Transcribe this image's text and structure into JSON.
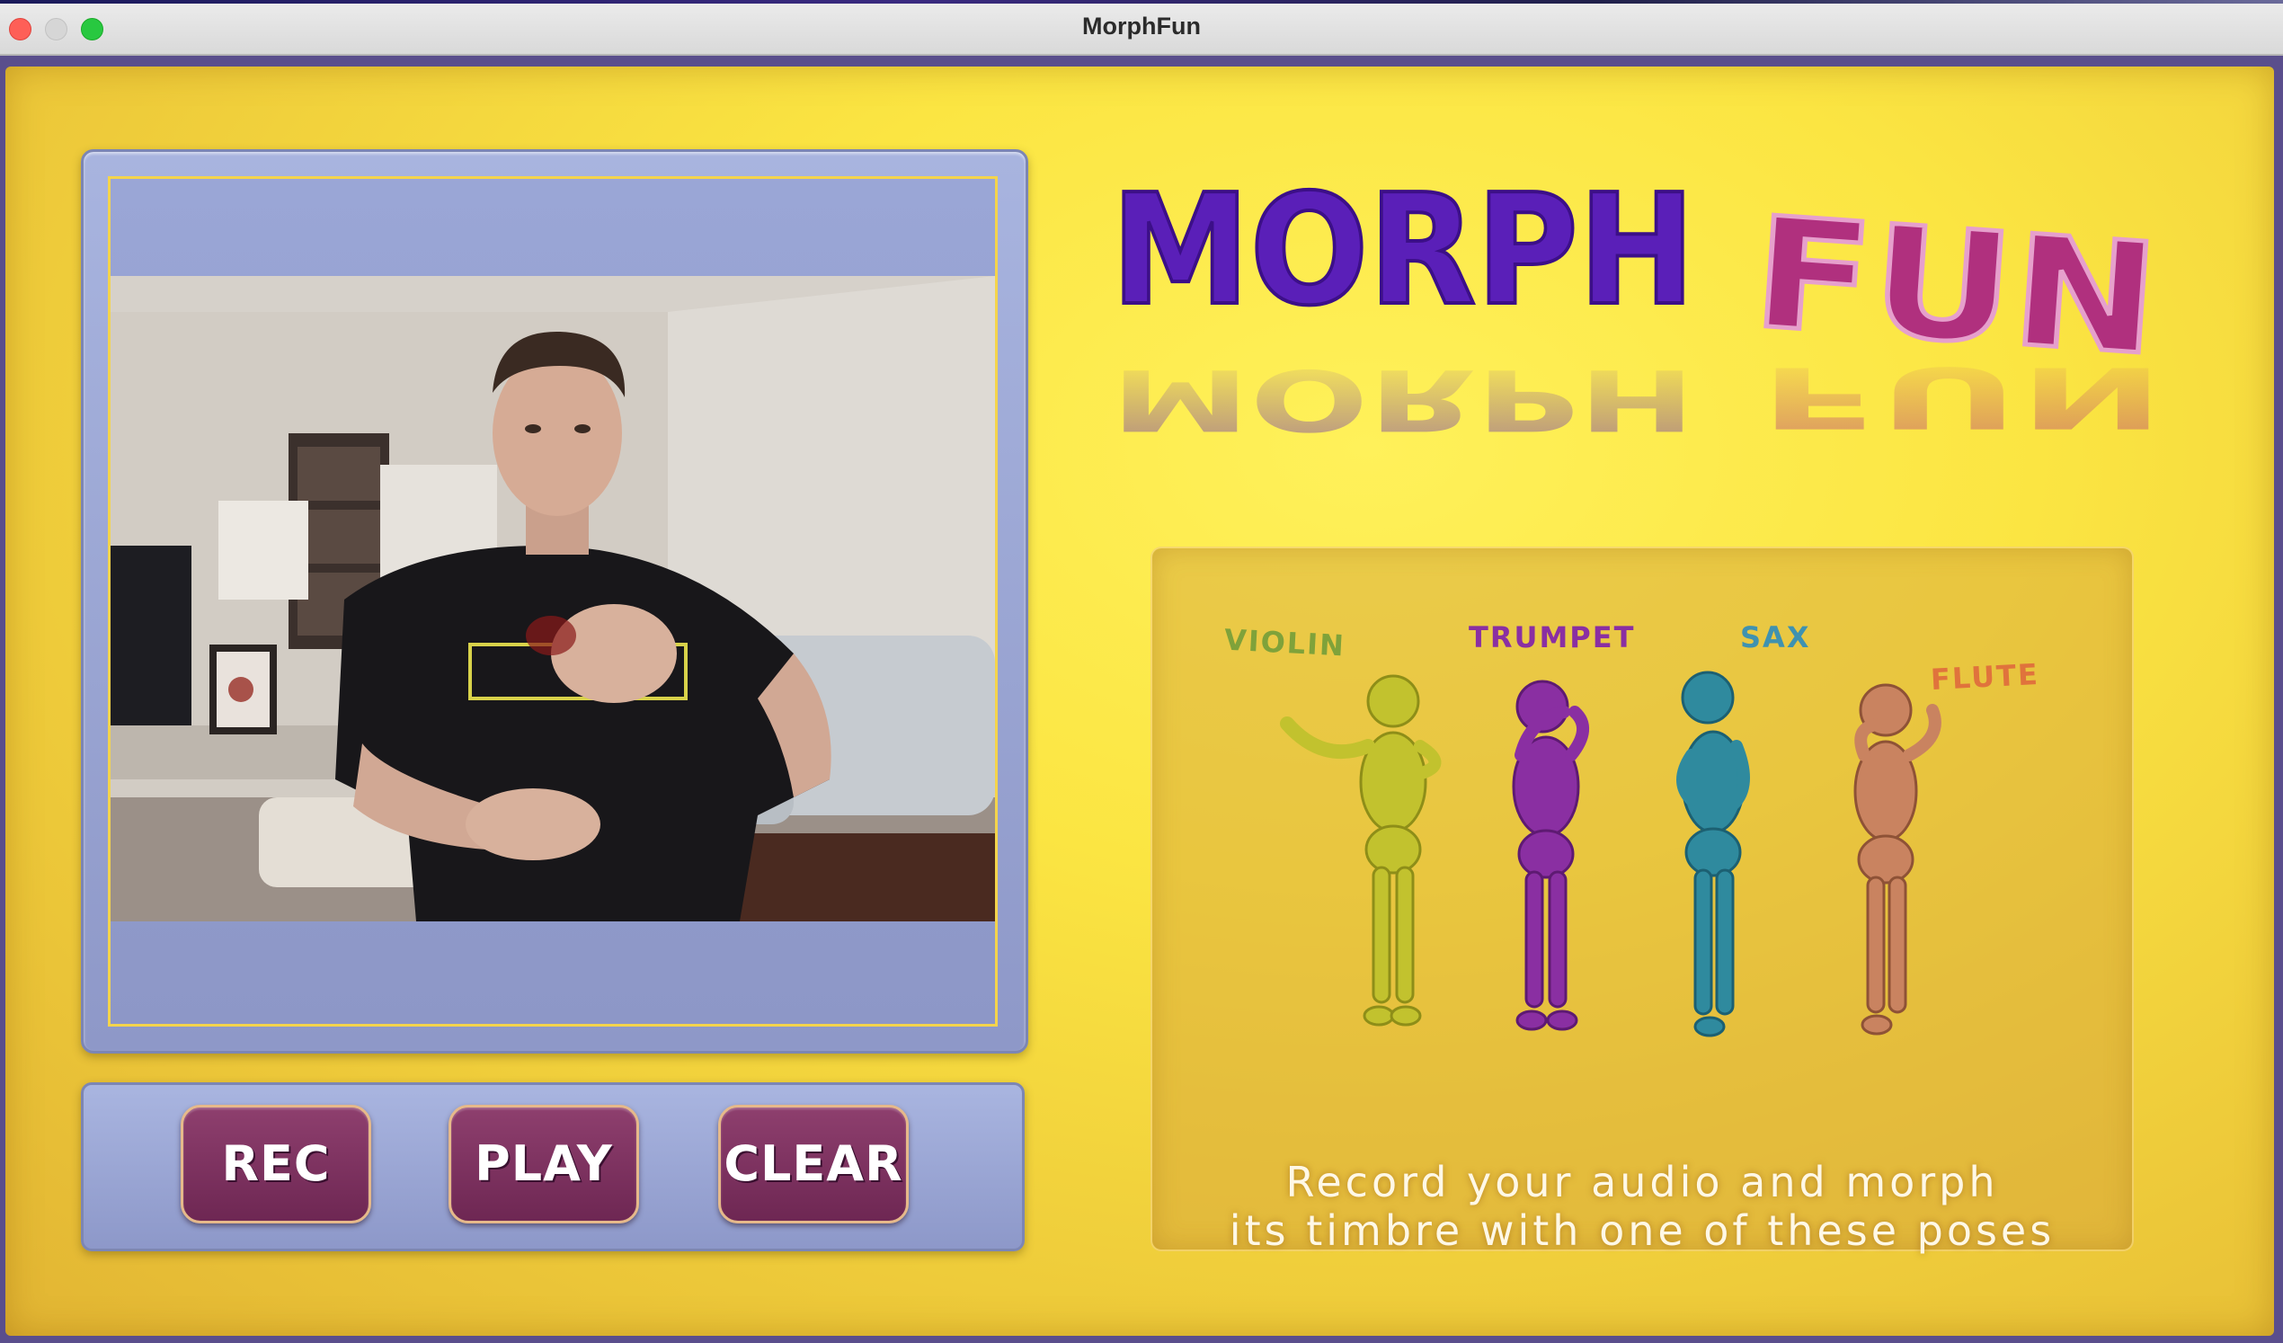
{
  "window": {
    "title": "MorphFun"
  },
  "logo": {
    "word1": "MORPH",
    "word2": "FUN",
    "colors": {
      "morph": "#5a1fb8",
      "fun": "#b0307e"
    }
  },
  "controls": {
    "rec_label": "REC",
    "play_label": "PLAY",
    "clear_label": "CLEAR"
  },
  "poses": {
    "items": [
      {
        "label": "VIOLIN",
        "color": "#b8b82a",
        "label_color": "#7fa23a"
      },
      {
        "label": "TRUMPET",
        "color": "#8a2fa2",
        "label_color": "#8a2fa2"
      },
      {
        "label": "SAX",
        "color": "#2f8a9e",
        "label_color": "#3f92b0"
      },
      {
        "label": "FLUTE",
        "color": "#c98360",
        "label_color": "#e0733c"
      }
    ],
    "caption_line1": "Record your audio and morph",
    "caption_line2": "its timbre with one of these poses"
  },
  "camera": {
    "description_icon": "camera-feed"
  },
  "colors": {
    "background": "#fbe542",
    "panel": "#9aa6d6",
    "button": "#7e3260"
  }
}
